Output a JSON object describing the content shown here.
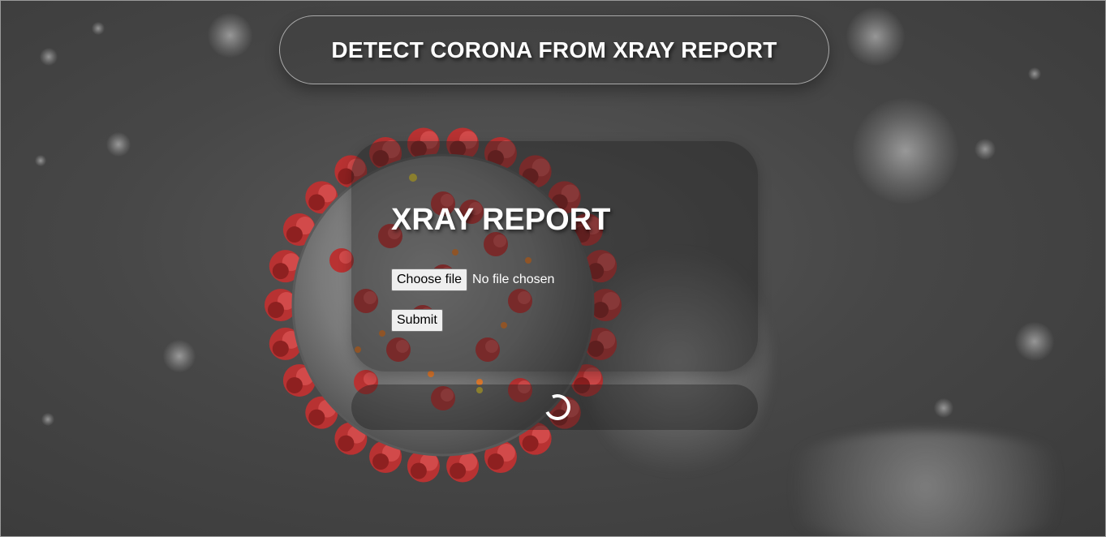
{
  "header": {
    "title": "DETECT CORONA FROM XRAY REPORT"
  },
  "form": {
    "heading": "XRAY REPORT",
    "choose_file_label": "Choose file",
    "file_status": "No file chosen",
    "submit_label": "Submit"
  },
  "loader": {
    "icon": "spinner-icon"
  },
  "colors": {
    "background": "#474747",
    "virus_spike": "#b83232",
    "text": "#ffffff"
  }
}
